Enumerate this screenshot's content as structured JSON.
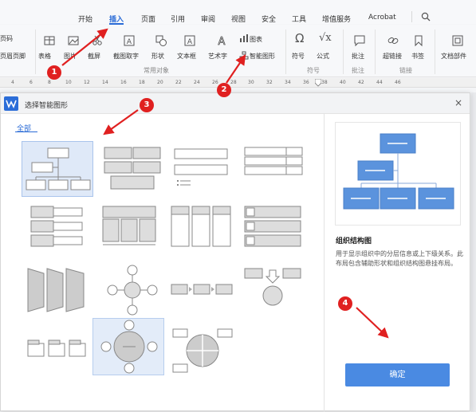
{
  "menu": {
    "tabs": [
      {
        "label": "开始"
      },
      {
        "label": "插入"
      },
      {
        "label": "页面"
      },
      {
        "label": "引用"
      },
      {
        "label": "审阅"
      },
      {
        "label": "视图"
      },
      {
        "label": "安全"
      },
      {
        "label": "工具"
      },
      {
        "label": "增值服务"
      },
      {
        "label": "Acrobat"
      }
    ],
    "active_tab": "插入"
  },
  "toolbar": {
    "partial_left_top": "页码",
    "partial_left_bottom": "页眉页脚",
    "table": "表格",
    "picture": "图片",
    "screenshot": "截屏",
    "screenshot_text": "截图取字",
    "shape": "形状",
    "textbox": "文本框",
    "wordart": "艺术字",
    "chart": "图表",
    "smartart": "智能图形",
    "group_common": "常用对象",
    "symbol": "符号",
    "formula": "公式",
    "group_symbol": "符号",
    "comment": "批注",
    "group_comment": "批注",
    "hyperlink": "超链接",
    "bookmark": "书签",
    "group_link": "链接",
    "doc_parts": "文档部件"
  },
  "ruler": {
    "ticks": [
      "4",
      "6",
      "8",
      "10",
      "12",
      "14",
      "16",
      "18",
      "20",
      "22",
      "24",
      "26",
      "28",
      "30",
      "32",
      "34",
      "36",
      "38",
      "40",
      "42",
      "44",
      "46"
    ]
  },
  "dialog": {
    "title": "选择智能图形",
    "close": "×",
    "category": "全部",
    "preview_title": "组织结构图",
    "preview_desc": "用于显示组织中的分层信息或上下级关系。此布局包含辅助形状和组织结构图悬挂布局。",
    "confirm": "确定"
  },
  "annotations": {
    "badges": [
      "1",
      "2",
      "3",
      "4"
    ],
    "color": "#e02020"
  },
  "colors": {
    "accent": "#2a6bd6",
    "button": "#4a8ae2",
    "preview_box": "#5b93dd"
  }
}
